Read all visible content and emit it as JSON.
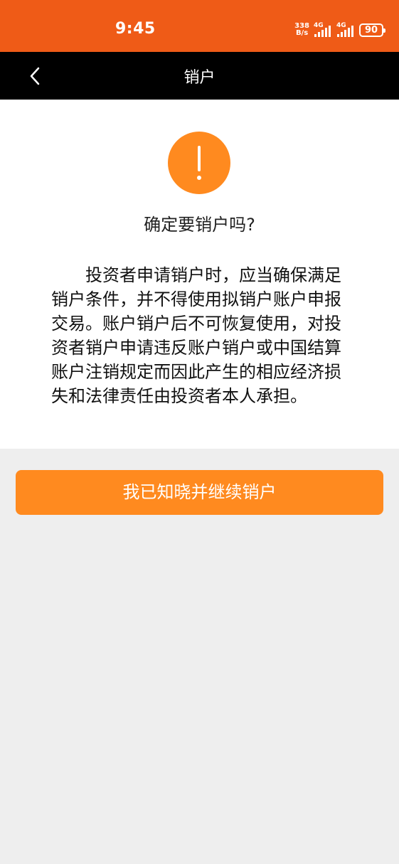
{
  "status_bar": {
    "time": "9:45",
    "net_speed_value": "338",
    "net_speed_unit": "B/s",
    "signal1_label": "4G",
    "signal2_label": "4G",
    "battery": "90"
  },
  "nav": {
    "title": "销户",
    "back_icon": "chevron-left-icon"
  },
  "content": {
    "warning_icon": "exclamation-circle-icon",
    "title": "确定要销户吗?",
    "notice": "投资者申请销户时，应当确保满足销户条件，并不得使用拟销户账户申报交易。账户销户后不可恢复使用，对投资者销户申请违反账户销户或中国结算账户注销规定而因此产生的相应经济损失和法律责任由投资者本人承担。"
  },
  "actions": {
    "continue_label": "我已知晓并继续销户"
  },
  "colors": {
    "status_bar_bg": "#ef5b17",
    "nav_bg": "#000000",
    "accent": "#ff8a1f",
    "page_bg": "#eeeeee"
  }
}
